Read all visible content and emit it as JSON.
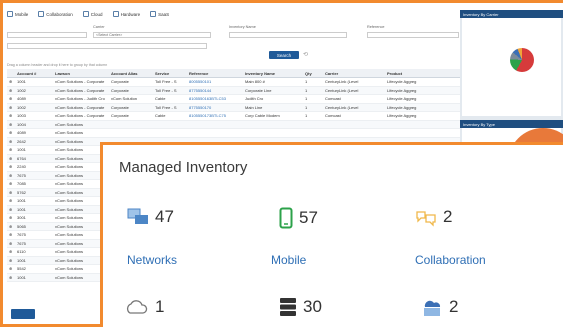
{
  "toolbar": {
    "items": [
      {
        "label": "Mobile",
        "icon": "mobile-icon"
      },
      {
        "label": "Collaboration",
        "icon": "collaboration-icon"
      },
      {
        "label": "Cloud",
        "icon": "cloud-icon"
      },
      {
        "label": "Hardware",
        "icon": "hardware-icon"
      },
      {
        "label": "SaaS",
        "icon": "saas-icon"
      }
    ]
  },
  "filters": {
    "carrier_label": "Carrier",
    "carrier_placeholder": "<Select Carrier>",
    "inventory_name_label": "Inventory Name",
    "reference_label": "Reference"
  },
  "search": {
    "button": "Search"
  },
  "table": {
    "group_hint": "Drag a column header and drop it here to group by that column",
    "headers": [
      "",
      "Account #",
      "Lawson",
      "Account Alias",
      "Service",
      "Reference",
      "Inventory Name",
      "Qty",
      "Carrier",
      "Product"
    ],
    "rows": [
      [
        "",
        "1001",
        "vCom Solutions - Corporate",
        "Corporate",
        "Toll Free - S",
        "8005550101",
        "Main 800 #",
        "1",
        "CenturyLink (Level",
        "Lifecycle Aggreg"
      ],
      [
        "",
        "1002",
        "vCom Solutions - Corporate",
        "Corporate",
        "Toll Free - S",
        "8775550144",
        "Corporate Line",
        "1",
        "CenturyLink (Level",
        "Lifecycle Aggreg"
      ],
      [
        "",
        "4089",
        "vCom Solutions - Judith Cro",
        "vCom Solution",
        "Cable",
        "8105550163BTLC53",
        "Judith Cro",
        "1",
        "Comcast",
        "Lifecycle Aggreg"
      ],
      [
        "",
        "1002",
        "vCom Solutions - Corporate",
        "Corporate",
        "Toll Free - S",
        "8775550170",
        "Main Line",
        "1",
        "CenturyLink (Level",
        "Lifecycle Aggreg"
      ],
      [
        "",
        "1003",
        "vCom Solutions - Corporate",
        "Corporate",
        "Cable",
        "8105550173BTLC75",
        "Corp Cable Modem",
        "1",
        "Comcast",
        "Lifecycle Aggreg"
      ],
      [
        "",
        "1004",
        "vCom Solutions",
        "",
        "",
        "",
        "",
        "",
        "",
        ""
      ],
      [
        "",
        "4089",
        "vCom Solutions",
        "",
        "",
        "",
        "",
        "",
        "",
        ""
      ],
      [
        "",
        "2642",
        "vCom Solutions",
        "",
        "",
        "",
        "",
        "",
        "",
        ""
      ],
      [
        "",
        "1001",
        "vCom Solutions",
        "",
        "",
        "",
        "",
        "",
        "",
        ""
      ],
      [
        "",
        "6764",
        "vCom Solutions",
        "",
        "",
        "",
        "",
        "",
        "",
        ""
      ],
      [
        "",
        "2240",
        "vCom Solutions",
        "",
        "",
        "",
        "",
        "",
        "",
        ""
      ],
      [
        "",
        "7675",
        "vCom Solutions",
        "",
        "",
        "",
        "",
        "",
        "",
        ""
      ],
      [
        "",
        "7085",
        "vCom Solutions",
        "",
        "",
        "",
        "",
        "",
        "",
        ""
      ],
      [
        "",
        "5762",
        "vCom Solutions",
        "",
        "",
        "",
        "",
        "",
        "",
        ""
      ],
      [
        "",
        "1001",
        "vCom Solutions",
        "",
        "",
        "",
        "",
        "",
        "",
        ""
      ],
      [
        "",
        "1001",
        "vCom Solutions",
        "",
        "",
        "",
        "",
        "",
        "",
        ""
      ],
      [
        "",
        "3001",
        "vCom Solutions",
        "",
        "",
        "",
        "",
        "",
        "",
        ""
      ],
      [
        "",
        "5065",
        "vCom Solutions",
        "",
        "",
        "",
        "",
        "",
        "",
        ""
      ],
      [
        "",
        "7675",
        "vCom Solutions",
        "",
        "",
        "",
        "",
        "",
        "",
        ""
      ],
      [
        "",
        "7675",
        "vCom Solutions",
        "",
        "",
        "",
        "",
        "",
        "",
        ""
      ],
      [
        "",
        "6110",
        "vCom Solutions",
        "",
        "",
        "",
        "",
        "",
        "",
        ""
      ],
      [
        "",
        "1001",
        "vCom Solutions",
        "",
        "",
        "",
        "",
        "",
        "",
        ""
      ],
      [
        "",
        "5542",
        "vCom Solutions",
        "",
        "",
        "",
        "",
        "",
        "",
        ""
      ],
      [
        "",
        "1001",
        "vCom Solutions",
        "",
        "",
        "",
        "",
        "",
        "",
        ""
      ]
    ]
  },
  "right_panel": {
    "by_carrier_title": "Inventory By Carrier",
    "by_type_title": "Inventory By Type"
  },
  "managed_inventory": {
    "title": "Managed Inventory",
    "tiles": [
      {
        "label": "Networks",
        "count": "47",
        "icon": "networks-icon"
      },
      {
        "label": "Mobile",
        "count": "57",
        "icon": "mobile-icon"
      },
      {
        "label": "Collaboration",
        "count": "2",
        "icon": "collaboration-icon"
      },
      {
        "label": "",
        "count": "1",
        "icon": "cloud-icon"
      },
      {
        "label": "",
        "count": "30",
        "icon": "hardware-icon"
      },
      {
        "label": "",
        "count": "2",
        "icon": "saas-icon"
      }
    ]
  },
  "colors": {
    "accent": "#f28a2e",
    "link": "#2f6fb5",
    "primary": "#1f5a99"
  }
}
